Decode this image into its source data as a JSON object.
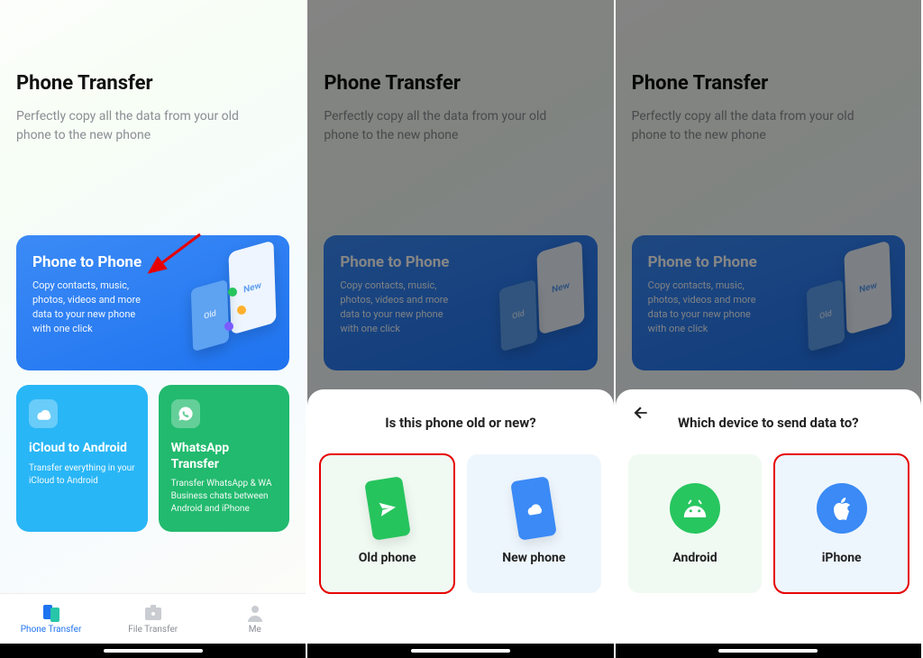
{
  "header": {
    "title": "Phone Transfer",
    "subtitle": "Perfectly copy all the data from your old phone to the new phone"
  },
  "cards": {
    "main": {
      "title": "Phone to Phone",
      "desc": "Copy contacts, music, photos, videos and more data to your new phone with one click",
      "badge_new": "New",
      "badge_old": "Old"
    },
    "icloud": {
      "title": "iCloud to Android",
      "desc": "Transfer everything in your iCloud to Android"
    },
    "whatsapp": {
      "title": "WhatsApp Transfer",
      "desc": "Transfer WhatsApp & WA Business chats between Android and iPhone"
    }
  },
  "nav": {
    "transfer": "Phone Transfer",
    "file": "File Transfer",
    "me": "Me"
  },
  "sheet1": {
    "title": "Is this phone old or new?",
    "old": "Old phone",
    "new": "New phone"
  },
  "sheet2": {
    "title": "Which device to send data to?",
    "android": "Android",
    "iphone": "iPhone"
  }
}
